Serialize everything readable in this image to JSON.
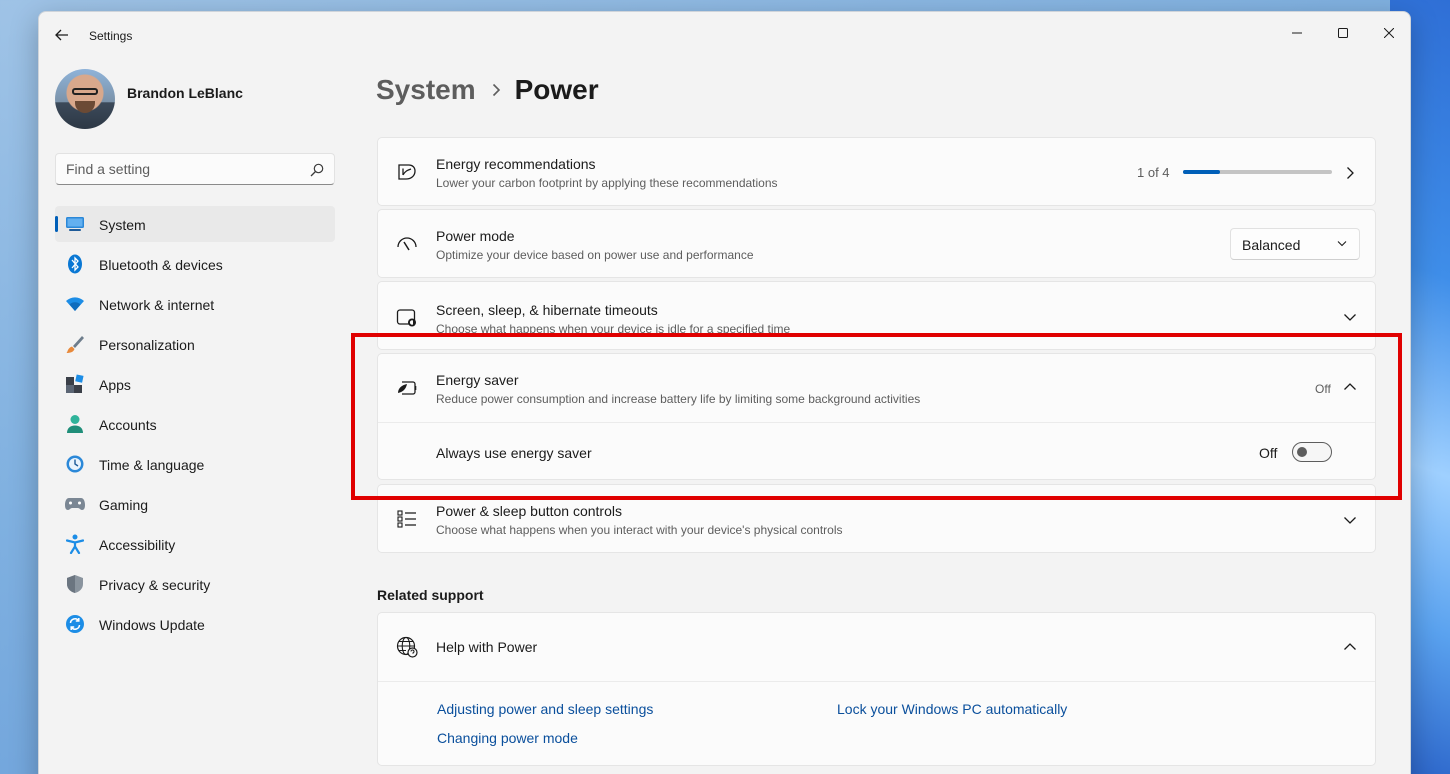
{
  "window": {
    "title": "Settings"
  },
  "profile": {
    "name": "Brandon LeBlanc"
  },
  "search": {
    "placeholder": "Find a setting"
  },
  "nav": {
    "items": [
      {
        "label": "System",
        "icon": "system-icon"
      },
      {
        "label": "Bluetooth & devices",
        "icon": "bluetooth-icon"
      },
      {
        "label": "Network & internet",
        "icon": "wifi-icon"
      },
      {
        "label": "Personalization",
        "icon": "brush-icon"
      },
      {
        "label": "Apps",
        "icon": "apps-icon"
      },
      {
        "label": "Accounts",
        "icon": "accounts-icon"
      },
      {
        "label": "Time & language",
        "icon": "time-language-icon"
      },
      {
        "label": "Gaming",
        "icon": "gaming-icon"
      },
      {
        "label": "Accessibility",
        "icon": "accessibility-icon"
      },
      {
        "label": "Privacy & security",
        "icon": "shield-icon"
      },
      {
        "label": "Windows Update",
        "icon": "update-icon"
      }
    ],
    "selected_index": 0
  },
  "breadcrumb": {
    "parent": "System",
    "current": "Power"
  },
  "settings": {
    "energy_recommendations": {
      "title": "Energy recommendations",
      "description": "Lower your carbon footprint by applying these recommendations",
      "progress_label": "1 of 4",
      "progress_fraction": 0.25
    },
    "power_mode": {
      "title": "Power mode",
      "description": "Optimize your device based on power use and performance",
      "selected": "Balanced"
    },
    "screen_sleep": {
      "title": "Screen, sleep, & hibernate timeouts",
      "description": "Choose what happens when your device is idle for a specified time"
    },
    "energy_saver": {
      "title": "Energy saver",
      "description": "Reduce power consumption and increase battery life by limiting some background activities",
      "state": "Off",
      "always_label": "Always use energy saver",
      "toggle_state": "Off"
    },
    "power_buttons": {
      "title": "Power & sleep button controls",
      "description": "Choose what happens when you interact with your device's physical controls"
    }
  },
  "related_support": {
    "heading": "Related support",
    "help_title": "Help with Power",
    "links": [
      "Adjusting power and sleep settings",
      "Lock your Windows PC automatically",
      "Changing power mode"
    ]
  },
  "colors": {
    "accent": "#005fb8",
    "highlight": "#e00000",
    "link": "#0a4f9c"
  }
}
